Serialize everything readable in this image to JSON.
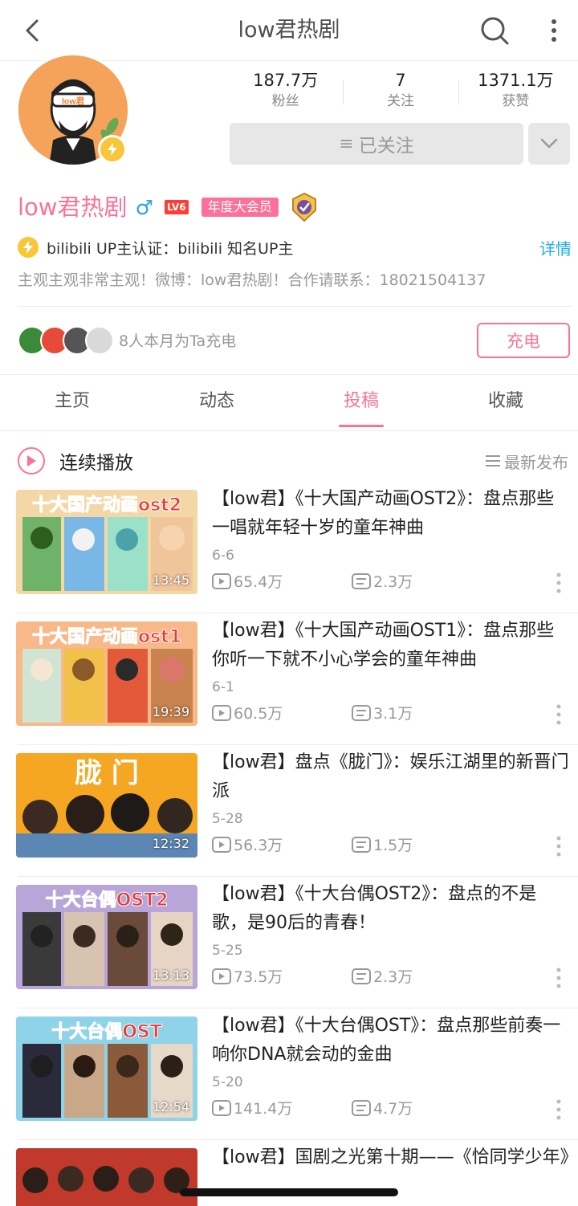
{
  "nav": {
    "title": "low君热剧"
  },
  "stats": [
    {
      "num": "187.7万",
      "label": "粉丝"
    },
    {
      "num": "7",
      "label": "关注"
    },
    {
      "num": "1371.1万",
      "label": "获赞"
    }
  ],
  "follow": {
    "icon": "≡",
    "label": "已关注"
  },
  "profile": {
    "name": "low君热剧",
    "gender": "♂",
    "level": "LV6",
    "vip": "年度大会员",
    "verify_text": "bilibili  UP主认证：bilibili  知名UP主",
    "detail": "详情",
    "bio": "主观主观非常主观！微博：low君热剧！合作请联系：18021504137",
    "avatar_badge": "low君"
  },
  "charge": {
    "text": "8人本月为Ta充电",
    "button": "充电"
  },
  "tabs": [
    "主页",
    "动态",
    "投稿",
    "收藏"
  ],
  "list_header": {
    "play_all": "连续播放",
    "sort": "最新发布"
  },
  "videos": [
    {
      "title": "【low君】《十大国产动画OST2》：盘点那些一唱就年轻十岁的童年神曲",
      "date": "6-6",
      "plays": "65.4万",
      "danmaku": "2.3万",
      "duration": "13:45",
      "thumb_text": "十大国产动画ost2"
    },
    {
      "title": "【low君】《十大国产动画OST1》：盘点那些你听一下就不小心学会的童年神曲",
      "date": "6-1",
      "plays": "60.5万",
      "danmaku": "3.1万",
      "duration": "19:39",
      "thumb_text": "十大国产动画ost1"
    },
    {
      "title": "【low君】盘点《胧门》：娱乐江湖里的新晋门派",
      "date": "5-28",
      "plays": "56.3万",
      "danmaku": "1.5万",
      "duration": "12:32",
      "thumb_text": "胧 门"
    },
    {
      "title": "【low君】《十大台偶OST2》：盘点的不是歌，是90后的青春！",
      "date": "5-25",
      "plays": "73.5万",
      "danmaku": "2.3万",
      "duration": "13:13",
      "thumb_text": "十大台偶OST2"
    },
    {
      "title": "【low君】《十大台偶OST》：盘点那些前奏一响你DNA就会动的金曲",
      "date": "5-20",
      "plays": "141.4万",
      "danmaku": "4.7万",
      "duration": "12:54",
      "thumb_text": "十大台偶OST"
    },
    {
      "title": "【low君】国剧之光第十期——《恰同学少年》",
      "date": "",
      "plays": "",
      "danmaku": "",
      "duration": "",
      "thumb_text": ""
    }
  ],
  "colors": {
    "accent": "#fb7299",
    "link": "#23ade5",
    "muted": "#999999"
  }
}
